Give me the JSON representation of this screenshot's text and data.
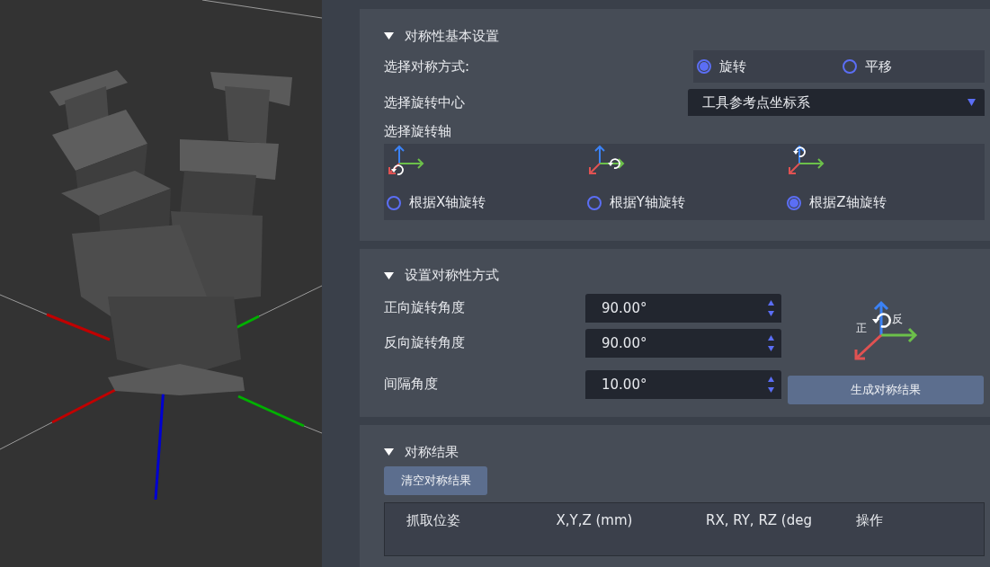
{
  "basic_settings": {
    "title": "对称性基本设置",
    "mode_label": "选择对称方式:",
    "modes": [
      {
        "label": "旋转",
        "selected": true
      },
      {
        "label": "平移",
        "selected": false
      }
    ],
    "center_label": "选择旋转中心",
    "center_value": "工具参考点坐标系",
    "axis_label": "选择旋转轴",
    "axes": [
      {
        "label": "根据X轴旋转",
        "selected": false
      },
      {
        "label": "根据Y轴旋转",
        "selected": false
      },
      {
        "label": "根据Z轴旋转",
        "selected": true
      }
    ]
  },
  "method": {
    "title": "设置对称性方式",
    "fields": [
      {
        "label": "正向旋转角度",
        "value": "90.00°"
      },
      {
        "label": "反向旋转角度",
        "value": "90.00°"
      },
      {
        "label": "间隔角度",
        "value": "10.00°"
      }
    ],
    "diagram": {
      "forward": "正",
      "reverse": "反"
    },
    "generate_button": "生成对称结果"
  },
  "results": {
    "title": "对称结果",
    "clear_button": "清空对称结果",
    "columns": [
      "抓取位姿",
      "X,Y,Z (mm)",
      "RX, RY, RZ (deg",
      "操作"
    ]
  }
}
